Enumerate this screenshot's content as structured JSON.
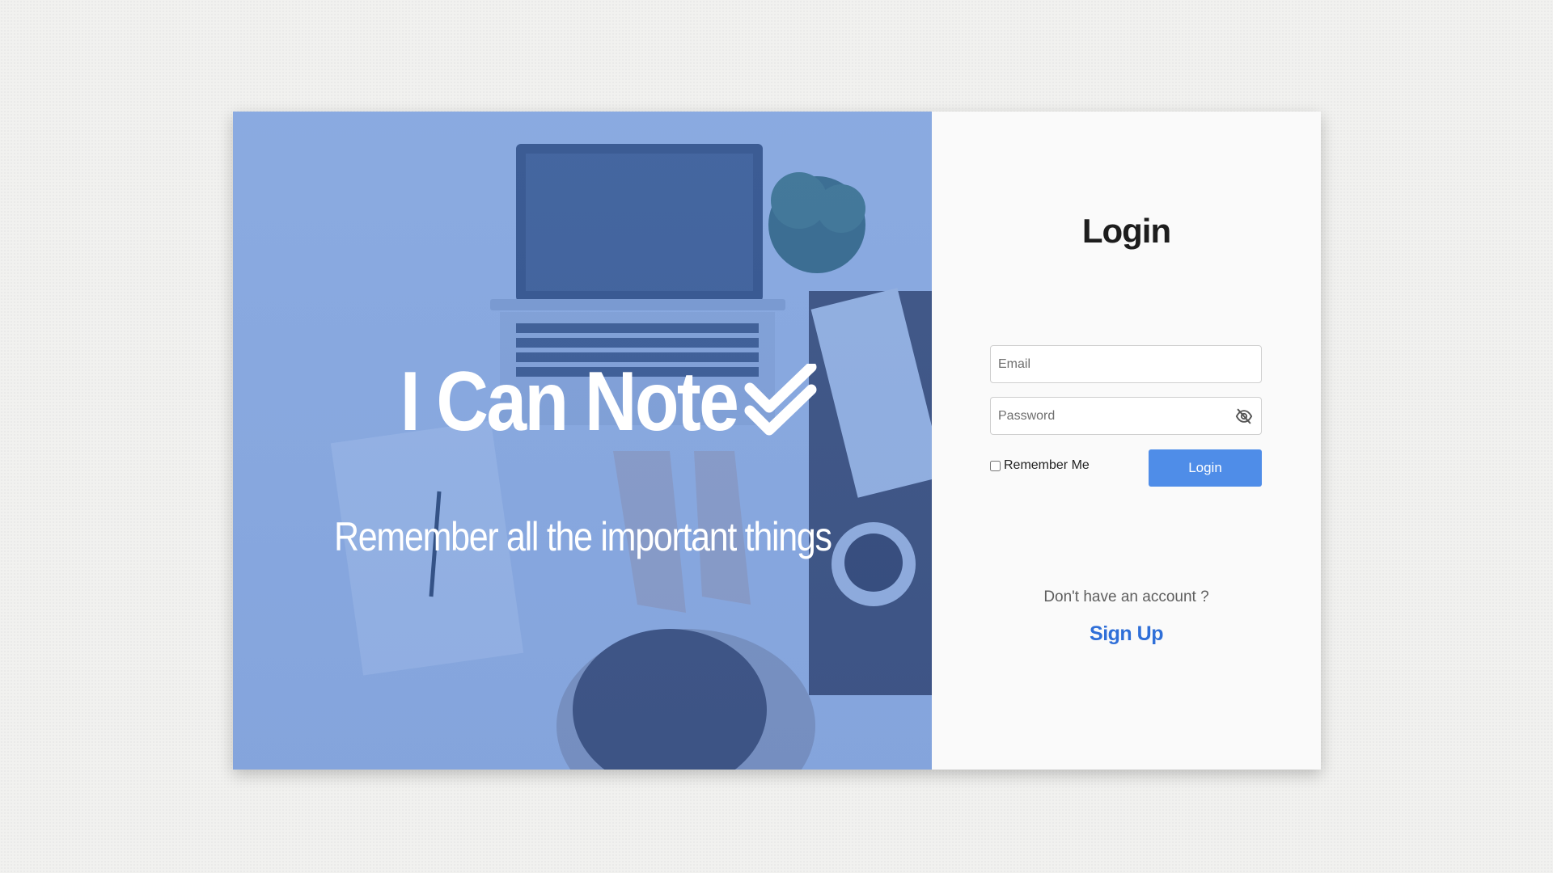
{
  "hero": {
    "title": "I Can Note",
    "title_icon": "double-check-icon",
    "tagline": "Remember all the important things"
  },
  "login": {
    "heading": "Login",
    "email": {
      "placeholder": "Email",
      "value": ""
    },
    "password": {
      "placeholder": "Password",
      "value": "",
      "toggle_icon": "eye-off-icon"
    },
    "remember_me": {
      "label": "Remember Me",
      "checked": false
    },
    "submit_label": "Login",
    "no_account_text": "Don't have an account ?",
    "signup_label": "Sign Up"
  },
  "colors": {
    "hero_overlay": "#4a81de",
    "primary_button": "#4f8de8",
    "link": "#2f6fd8",
    "panel_background": "#fafafa"
  }
}
